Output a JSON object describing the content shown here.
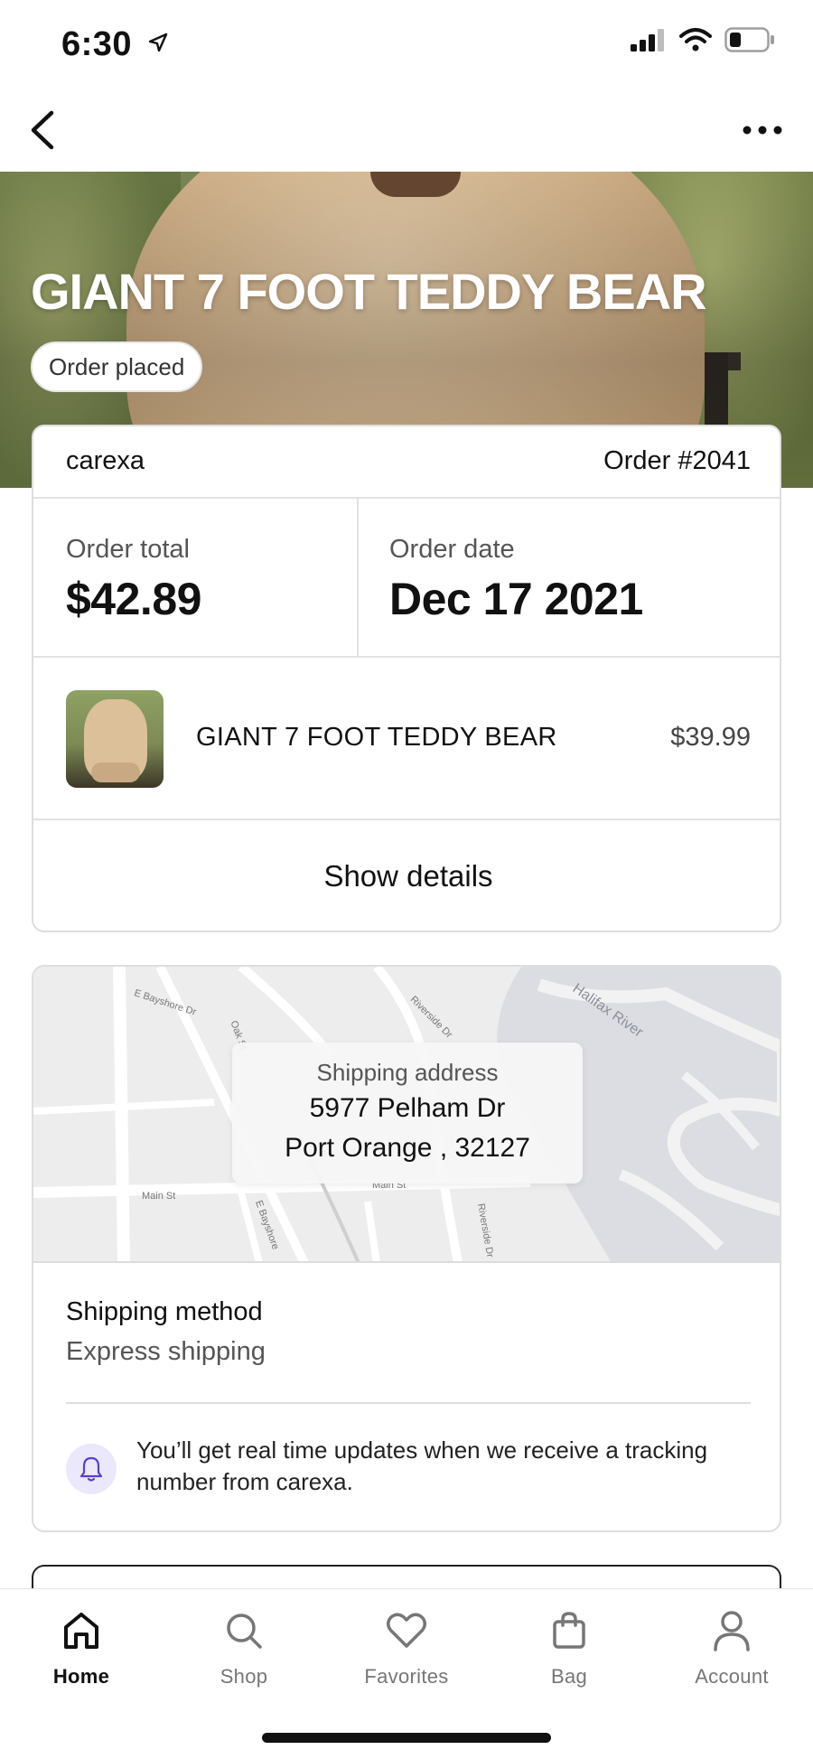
{
  "status_bar": {
    "time": "6:30",
    "icons": [
      "location-arrow-icon",
      "cellular-signal-icon",
      "wifi-icon",
      "battery-icon"
    ]
  },
  "nav": {
    "back_icon": "chevron-left-icon",
    "more_icon": "more-horizontal-icon"
  },
  "hero": {
    "title": "GIANT 7 FOOT TEDDY BEAR",
    "status": "Order placed"
  },
  "order": {
    "shop": "carexa",
    "order_number": "Order #2041",
    "total_label": "Order total",
    "total_value": "$42.89",
    "date_label": "Order date",
    "date_value": "Dec 17 2021",
    "item": {
      "name": "GIANT 7 FOOT TEDDY BEAR",
      "price": "$39.99"
    },
    "show_details": "Show details"
  },
  "shipping": {
    "map_labels": {
      "street_1": "E Bayshore Dr",
      "street_2": "Oak St",
      "street_3": "Riverside Dr",
      "river": "Halifax River",
      "street_4": "Main St",
      "street_5": "Main St",
      "street_6": "E Bayshore",
      "street_7": "Riverside Dr"
    },
    "address_label": "Shipping address",
    "address_line1": "5977 Pelham Dr",
    "address_line2": "Port Orange , 32127",
    "method_label": "Shipping method",
    "method_value": "Express shipping",
    "notice": "You’ll get real time updates when we receive a tracking number from carexa.",
    "notice_icon": "bell-icon",
    "accent_color": "#ece8fb"
  },
  "tabs": [
    {
      "label": "Home",
      "icon": "home-icon",
      "active": true
    },
    {
      "label": "Shop",
      "icon": "search-icon",
      "active": false
    },
    {
      "label": "Favorites",
      "icon": "heart-icon",
      "active": false
    },
    {
      "label": "Bag",
      "icon": "bag-icon",
      "active": false
    },
    {
      "label": "Account",
      "icon": "user-icon",
      "active": false
    }
  ]
}
